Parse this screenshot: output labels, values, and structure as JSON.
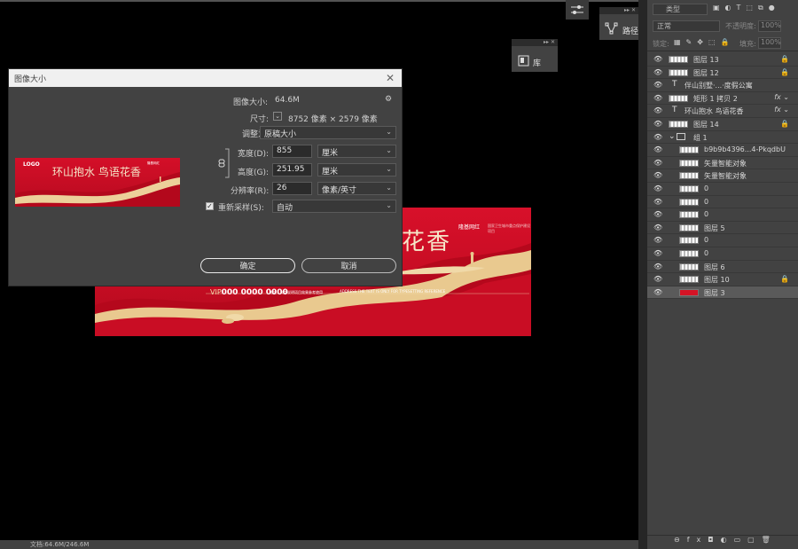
{
  "canvas": {
    "big_title": "花香",
    "brand": "隆基网红",
    "brand_sub": "国家卫生城市重点保护建设项目",
    "vip_label": "VIP",
    "vip_number": "000 0000 0000",
    "vip_note": "地址：文字说明项目效果参考使用",
    "address_text": "ADDRESS THE TEXT IS ONLY FOR TYPESETTING REFERENCE"
  },
  "dialog": {
    "title": "图像大小",
    "close": "✕",
    "image_size_label": "图像大小:",
    "image_size_value": "64.6M",
    "gear": "⚙",
    "dimensions_label": "尺寸:",
    "dimensions_value": "8752 像素 × 2579 像素",
    "fit_label": "调整为:",
    "fit_value": "原稿大小",
    "width_label": "宽度(D):",
    "width_value": "855",
    "width_unit": "厘米",
    "height_label": "高度(G):",
    "height_value": "251.95",
    "height_unit": "厘米",
    "resolution_label": "分辨率(R):",
    "resolution_value": "26",
    "resolution_unit": "像素/英寸",
    "resample_label": "重新采样(S):",
    "resample_value": "自动",
    "ok": "确定",
    "cancel": "取消",
    "thumb_logo": "LOGO",
    "thumb_title": "环山抱水 鸟语花香",
    "thumb_brand": "隆基网红"
  },
  "panels": {
    "path": "路径",
    "library": "库",
    "collapse": "▸▸ ✕"
  },
  "layers": {
    "kind": "类型",
    "blend": "正常",
    "opacity_label": "不透明度:",
    "opacity_value": "100%",
    "lock_label": "锁定:",
    "fill_label": "填充:",
    "fill_value": "100%",
    "items": [
      {
        "name": "图层 13",
        "type": "pixel",
        "locked": true
      },
      {
        "name": "图层 12",
        "type": "pixel",
        "locked": true
      },
      {
        "name": "伴山别墅·...·度假公寓",
        "type": "text"
      },
      {
        "name": "矩形 1 拷贝 2",
        "type": "shape",
        "fx": true
      },
      {
        "name": "环山抱水 鸟语花香",
        "type": "text",
        "fx": true
      },
      {
        "name": "图层 14",
        "type": "pixel",
        "locked": true
      },
      {
        "name": "组 1",
        "type": "group"
      },
      {
        "name": "b9b9b4396...4-PkqdbU",
        "type": "pixel"
      },
      {
        "name": "矢量智能对象",
        "type": "pixel"
      },
      {
        "name": "矢量智能对象",
        "type": "pixel"
      },
      {
        "name": "0",
        "type": "pixel"
      },
      {
        "name": "0",
        "type": "pixel"
      },
      {
        "name": "0",
        "type": "pixel"
      },
      {
        "name": "图层 5",
        "type": "pixel"
      },
      {
        "name": "0",
        "type": "pixel"
      },
      {
        "name": "0",
        "type": "pixel"
      },
      {
        "name": "图层 6",
        "type": "pixel"
      },
      {
        "name": "图层 10",
        "type": "pixel",
        "locked": true
      },
      {
        "name": "图层 3",
        "type": "pixel-red",
        "selected": true
      }
    ]
  },
  "status": {
    "doc": "文档:64.6M/246.6M"
  }
}
